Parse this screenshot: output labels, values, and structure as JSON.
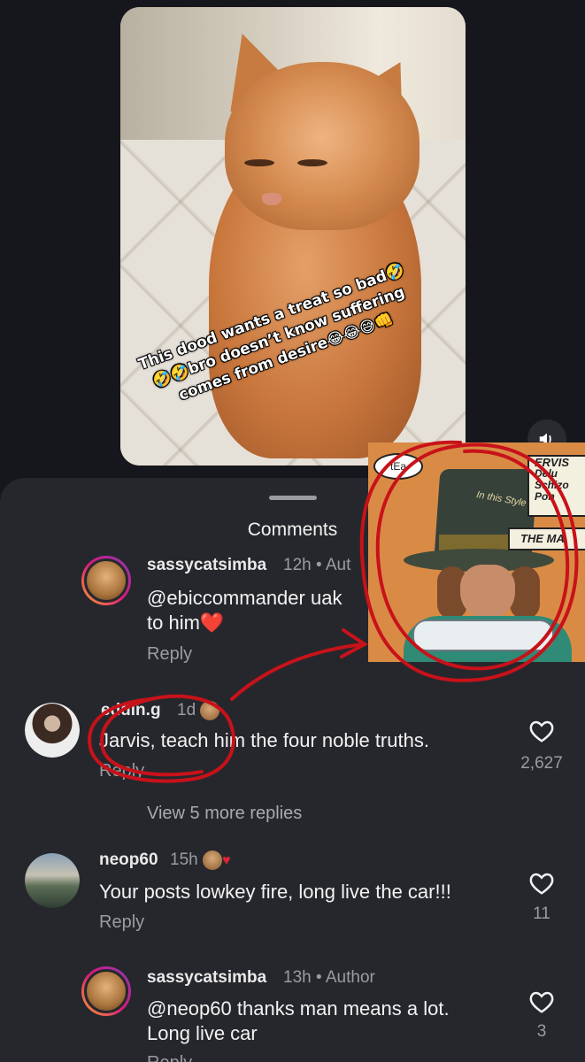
{
  "post": {
    "caption": "This dood wants a treat so bad🤣🤣🤣bro doesn’t know suffering comes from desire😂😂😅👊"
  },
  "comments_sheet": {
    "title": "Comments",
    "comments": [
      {
        "username": "sassycatsimba",
        "time": "12h",
        "badge": "Aut",
        "text_mention": "@ebiccommander",
        "text": "uak",
        "text_line2": "to him❤️",
        "reply_label": "Reply"
      },
      {
        "username": "eddin.g",
        "time": "1d",
        "text": "Jarvis, teach him the four noble truths.",
        "reply_label": "Reply",
        "like_count": "2,627",
        "view_more": "View 5 more replies"
      },
      {
        "username": "neop60",
        "time": "15h",
        "text": "Your posts lowkey fire, long live the car!!!",
        "reply_label": "Reply",
        "like_count": "11"
      },
      {
        "username": "sassycatsimba",
        "time": "13h",
        "badge": "Author",
        "text_mention": "@neop60",
        "text": "thanks man means a lot.",
        "text_line2": "Long live car",
        "reply_label": "Reply",
        "like_count": "3"
      }
    ]
  },
  "meme_overlay": {
    "bubble": "tEa",
    "hat_note": "In this Style",
    "box_lines": [
      "ERVIS",
      "Delu",
      "Schizo",
      "Pon"
    ],
    "banner": "THE MA"
  },
  "colors": {
    "sheet_bg": "#26272c",
    "annotation_red": "#c8121a",
    "story_ring": "#d91a7a"
  }
}
